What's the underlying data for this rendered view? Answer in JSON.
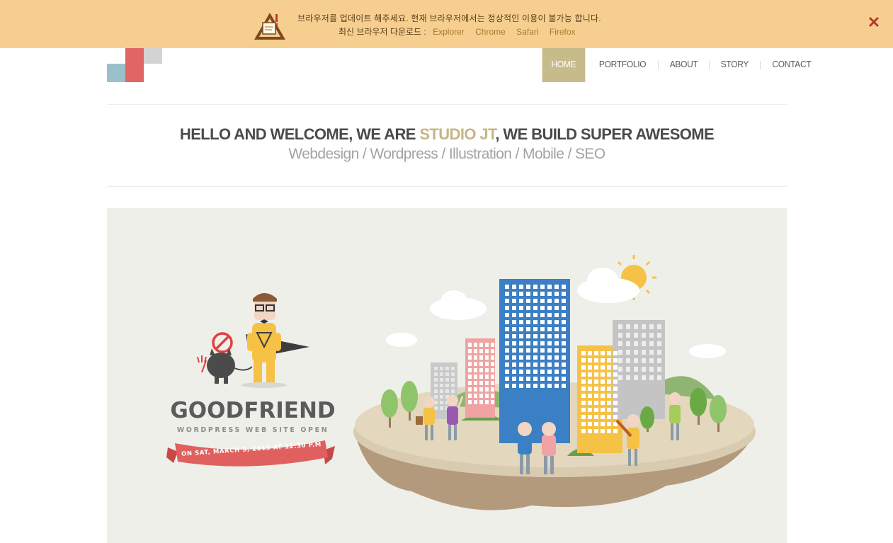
{
  "notice": {
    "message": "브라우저를 업데이트 해주세요. 현재 브라우저에서는 정상적인 이용이 불가능 합니다.",
    "download_label": "최신 브라우저 다운로드 :",
    "browsers": [
      "Explorer",
      "Chrome",
      "Safari",
      "Firefox"
    ],
    "close_glyph": "✕",
    "icon": "warning-icon"
  },
  "nav": {
    "items": [
      "HOME",
      "PORTFOLIO",
      "ABOUT",
      "STORY",
      "CONTACT"
    ],
    "active": "HOME"
  },
  "headline": {
    "part1": "HELLO AND WELCOME, WE ARE ",
    "highlight": "STUDIO JT",
    "part2": ", WE BUILD SUPER AWESOME",
    "services": "Webdesign / Wordpress / Illustration / Mobile / SEO"
  },
  "hero": {
    "title": "GOODFRIEND",
    "subtitle": "WORDPRESS WEB SITE OPEN",
    "date": "ON SAT, MARCH 9, 2013 AT 12:30 P.M"
  },
  "colors": {
    "notice_bg": "#f6cf90",
    "accent": "#c7bb8c",
    "headline_highlight": "#c5b684",
    "hero_bg": "#efefea",
    "ribbon": "#e06060"
  }
}
